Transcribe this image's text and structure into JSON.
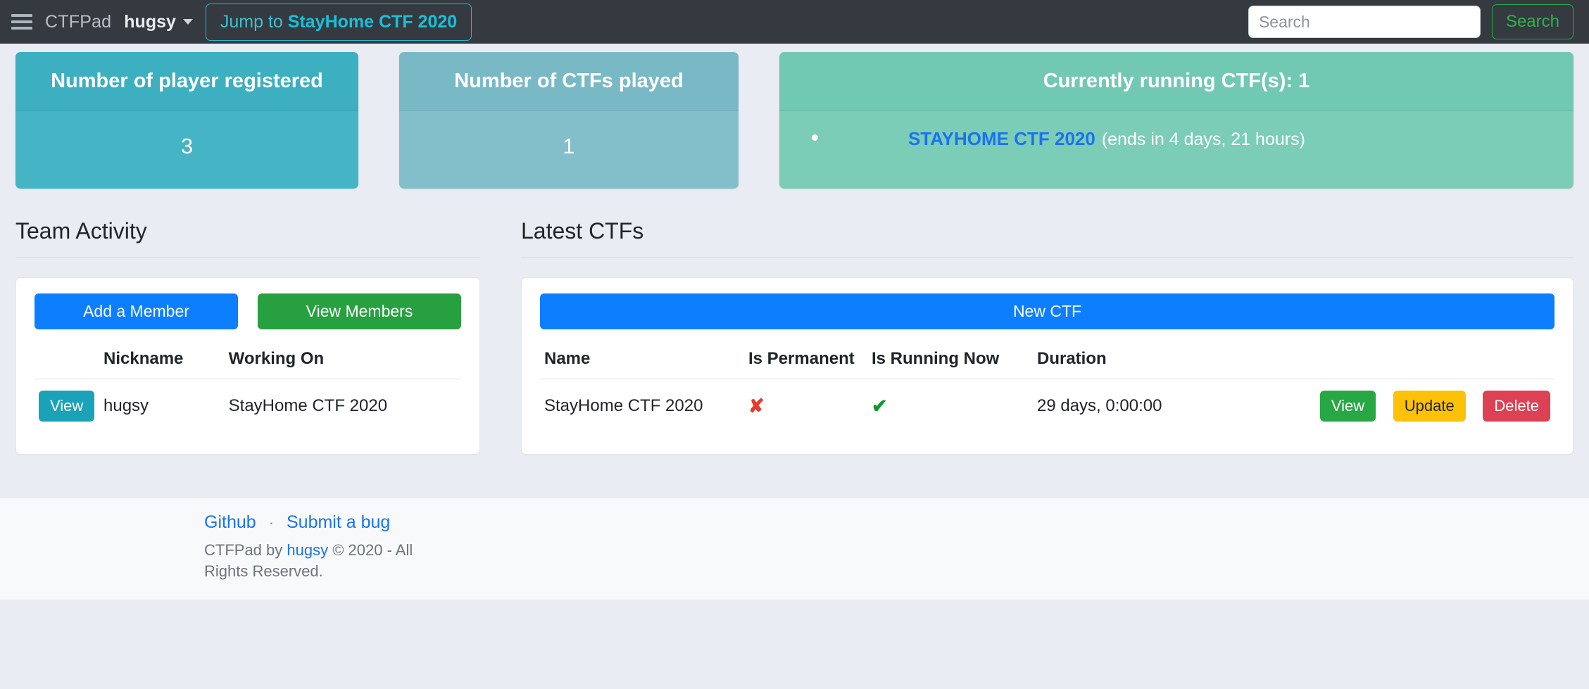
{
  "navbar": {
    "menu_icon": "hamburger-icon",
    "brand": "CTFPad",
    "username": "hugsy",
    "jump_prefix": "Jump to ",
    "jump_target": "StayHome CTF 2020",
    "search_placeholder": "Search",
    "search_value": "",
    "search_button": "Search"
  },
  "stats": {
    "players": {
      "title": "Number of player registered",
      "value": "3"
    },
    "ctfs_played": {
      "title": "Number of CTFs played",
      "value": "1"
    },
    "running": {
      "title": "Currently running CTF(s): 1",
      "items": [
        {
          "name": "STAYHOME CTF 2020",
          "note": "(ends in 4 days, 21 hours)"
        }
      ]
    }
  },
  "team_activity": {
    "title": "Team Activity",
    "add_member_label": "Add a Member",
    "view_members_label": "View Members",
    "columns": [
      "",
      "Nickname",
      "Working On"
    ],
    "rows": [
      {
        "action": "View",
        "nickname": "hugsy",
        "working_on": "StayHome CTF 2020"
      }
    ]
  },
  "latest_ctfs": {
    "title": "Latest CTFs",
    "new_ctf_label": "New CTF",
    "columns": [
      "Name",
      "Is Permanent",
      "Is Running Now",
      "Duration",
      ""
    ],
    "rows": [
      {
        "name": "StayHome CTF 2020",
        "is_permanent": "✘",
        "is_running_now": "✔",
        "duration": "29 days, 0:00:00",
        "view_label": "View",
        "update_label": "Update",
        "delete_label": "Delete"
      }
    ]
  },
  "footer": {
    "github_label": "Github",
    "separator": "·",
    "bug_label": "Submit a bug",
    "copy_prefix": "CTFPad by ",
    "copy_author": "hugsy",
    "copy_suffix": " © 2020 - All Rights Reserved."
  },
  "colors": {
    "navbar_bg": "#343a40",
    "primary": "#0d7efd",
    "success": "#27a03f",
    "info": "#1aa2b8",
    "warning": "#fdc107",
    "danger": "#dc4253",
    "teal_card": "#3cafc0",
    "teal_card_light": "#79b9c6",
    "green_card": "#72c9b3",
    "link": "#1a73f0",
    "page_bg": "#e9ecf2"
  }
}
